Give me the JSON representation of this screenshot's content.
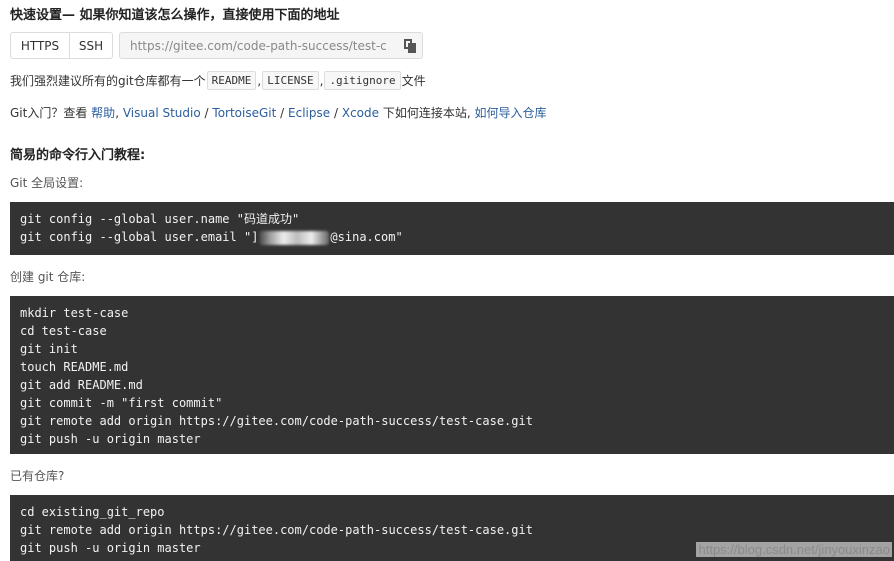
{
  "quick_setup": {
    "title": "快速设置— 如果你知道该怎么操作，直接使用下面的地址",
    "https_label": "HTTPS",
    "ssh_label": "SSH",
    "clone_url": "https://gitee.com/code-path-success/test-c",
    "copy_icon": "copy-icon"
  },
  "recommend": {
    "prefix": "我们强烈建议所有的git仓库都有一个",
    "tag_readme": "README",
    "sep1": ",",
    "tag_license": "LICENSE",
    "sep2": ",",
    "tag_gitignore": ".gitignore",
    "suffix": "文件"
  },
  "help_line": {
    "prefix": "Git入门？查看",
    "help_link": "帮助",
    "sep1": ",",
    "vs_link": "Visual Studio",
    "sep2": "/",
    "tortoise_link": "TortoiseGit",
    "sep3": "/",
    "eclipse_link": "Eclipse",
    "sep4": "/",
    "xcode_link": "Xcode",
    "middle": "下如何连接本站,",
    "import_link": "如何导入仓库"
  },
  "tutorial": {
    "title": "简易的命令行入门教程:",
    "global_label": "Git 全局设置:",
    "global_line1": "git config --global user.name \"码道成功\"",
    "global_line2_prefix": "git config --global user.email \"]",
    "global_line2_suffix": "@sina.com\"",
    "create_label": "创建 git 仓库:",
    "create_lines": [
      "mkdir test-case",
      "cd test-case",
      "git init",
      "touch README.md",
      "git add README.md",
      "git commit -m \"first commit\"",
      "git remote add origin https://gitee.com/code-path-success/test-case.git",
      "git push -u origin master"
    ],
    "existing_label": "已有仓库?",
    "existing_lines": [
      "cd existing_git_repo",
      "git remote add origin https://gitee.com/code-path-success/test-case.git",
      "git push -u origin master"
    ]
  },
  "watermark": "https://blog.csdn.net/jinyouxinzao"
}
